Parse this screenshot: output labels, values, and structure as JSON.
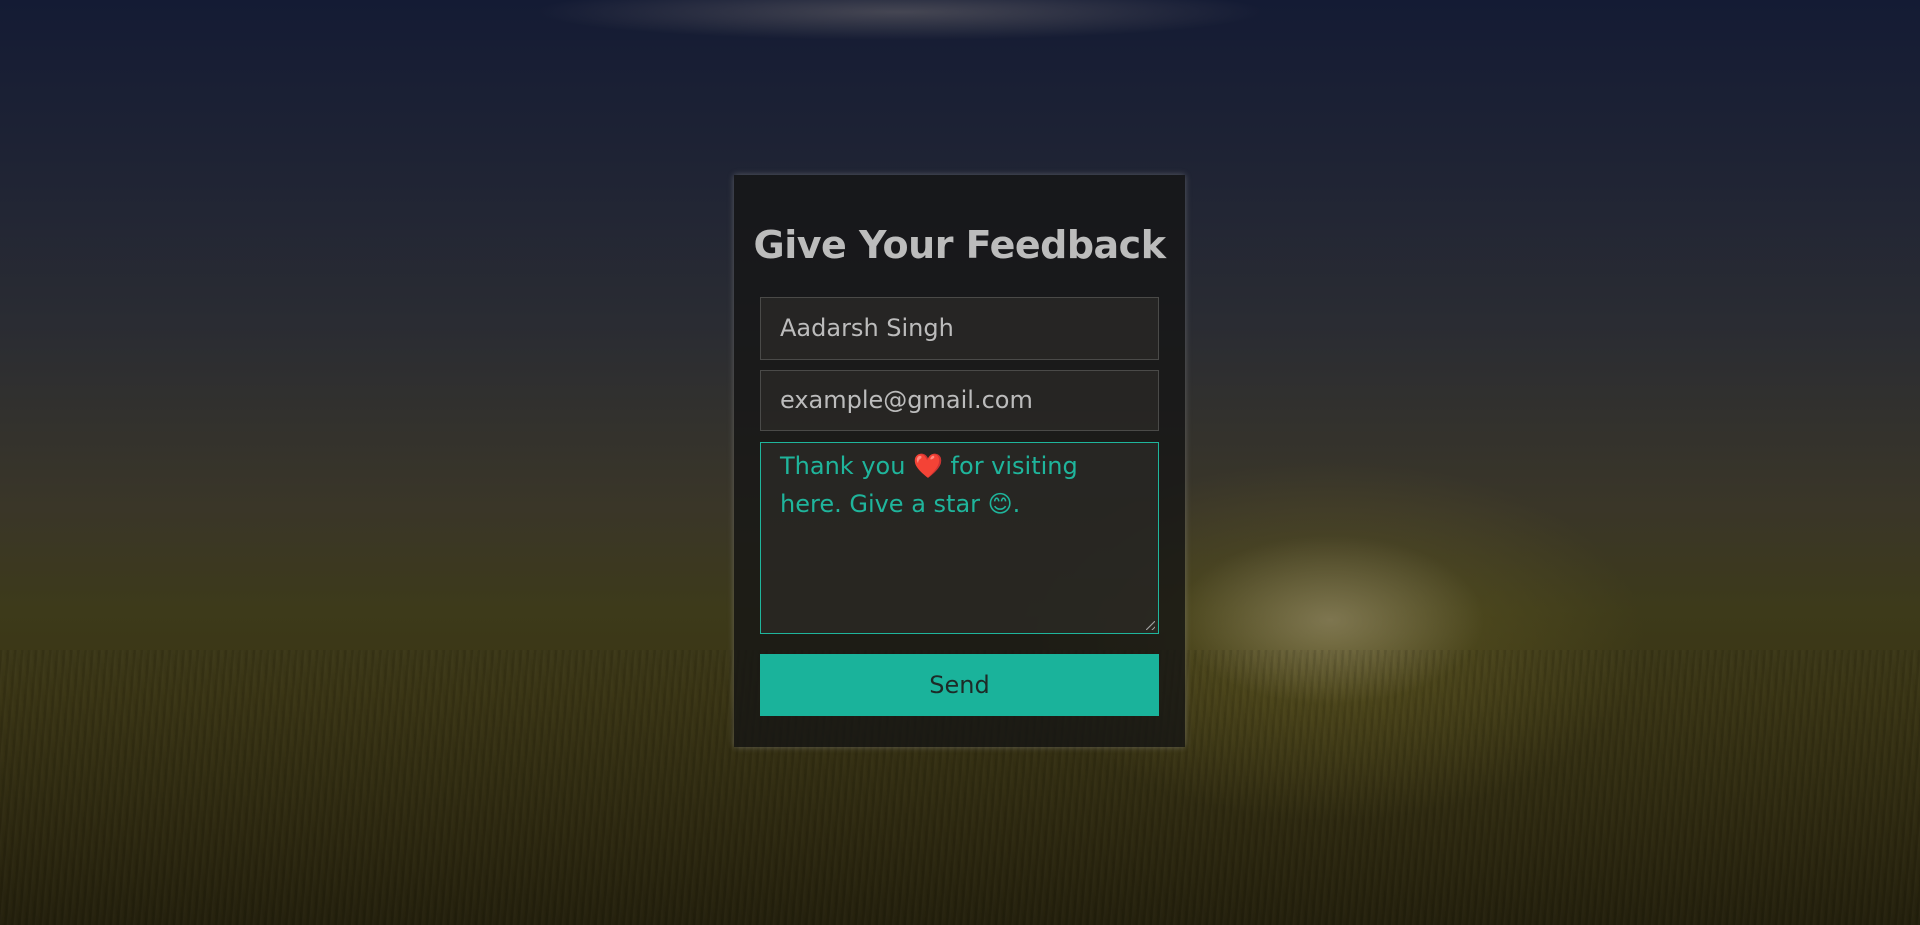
{
  "form": {
    "title": "Give Your Feedback",
    "name_value": "Aadarsh Singh",
    "email_value": "example@gmail.com",
    "message_value": "Thank you ❤️ for visiting here. Give a star 😊.",
    "send_label": "Send"
  },
  "colors": {
    "accent": "#1ab39b",
    "card_background": "#141414",
    "title_text": "#bcbcbc"
  }
}
